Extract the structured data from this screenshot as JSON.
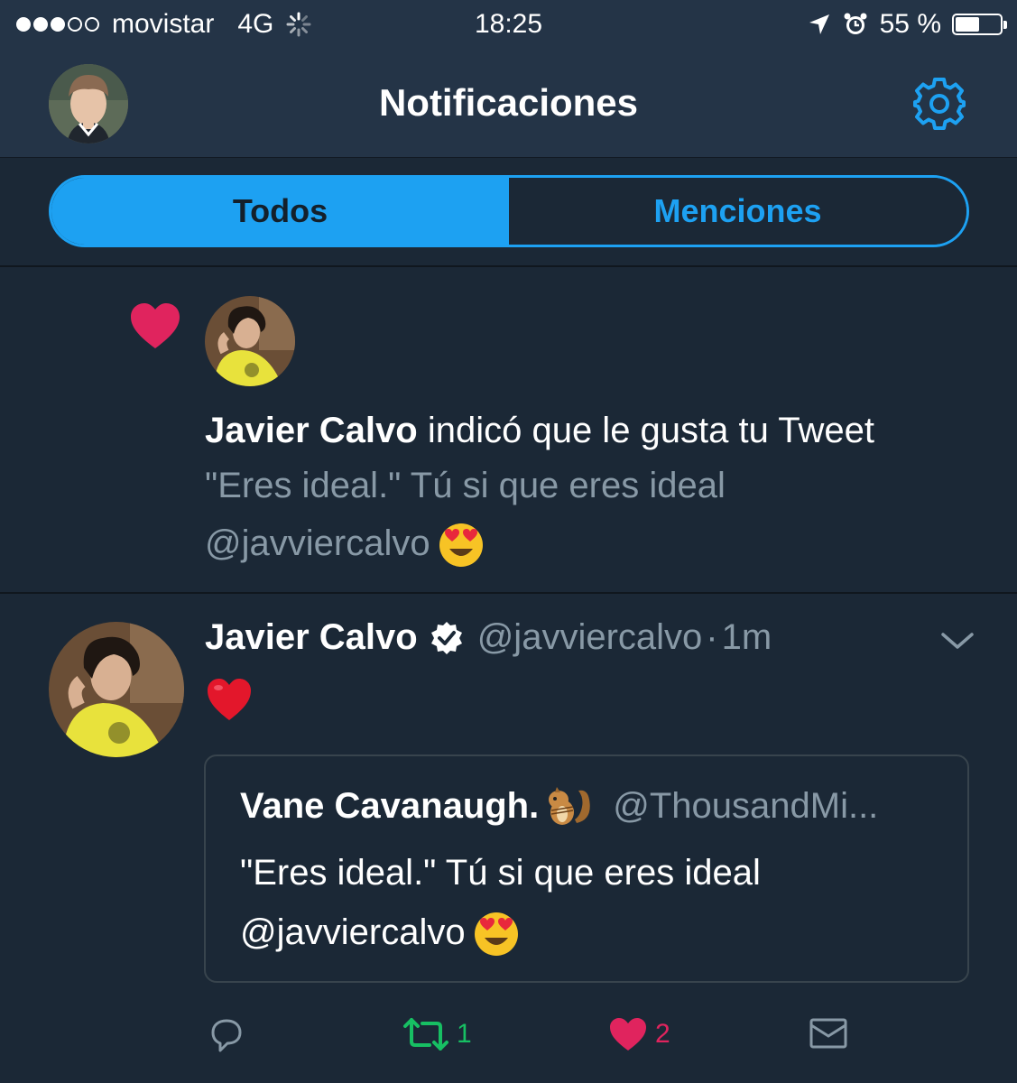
{
  "status_bar": {
    "carrier": "movistar",
    "network": "4G",
    "time": "18:25",
    "battery": "55 %",
    "battery_level": 0.55
  },
  "navbar": {
    "title": "Notificaciones",
    "avatar_icon": "profile-avatar",
    "settings_icon": "gear-icon"
  },
  "tabs": [
    {
      "label": "Todos",
      "active": true
    },
    {
      "label": "Menciones",
      "active": false
    }
  ],
  "notification": {
    "icon": "heart-icon",
    "actor": "Javier Calvo",
    "action_text": "indicó que le gusta tu Tweet",
    "quoted_text": "\"Eres ideal.\" Tú si que eres ideal",
    "quoted_mention": "@javviercalvo"
  },
  "tweet": {
    "name": "Javier Calvo",
    "handle": "@javviercalvo",
    "separator": "·",
    "time": "1m",
    "quote": {
      "name": "Vane Cavanaugh.",
      "handle": "@ThousandMi...",
      "text_line1": "\"Eres ideal.\" Tú si que eres ideal",
      "text_mention": "@javviercalvo"
    },
    "actions": {
      "retweets": "1",
      "likes": "2"
    }
  },
  "colors": {
    "accent": "#1da1f2",
    "background": "#1b2836",
    "bar": "#243447",
    "muted": "#8899a6",
    "like": "#e0245e",
    "retweet": "#17bf63"
  }
}
